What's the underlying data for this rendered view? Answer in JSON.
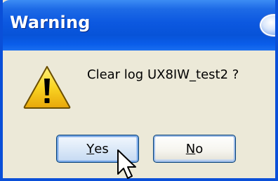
{
  "window": {
    "title": "Warning",
    "message": "Clear log UX8IW_test2 ?"
  },
  "buttons": {
    "yes": {
      "mnemonic": "Y",
      "rest": "es"
    },
    "no": {
      "mnemonic": "N",
      "rest": "o"
    }
  },
  "icons": {
    "warning": "warning-triangle-icon",
    "close": "close-icon",
    "cursor": "mouse-pointer-icon"
  },
  "colors": {
    "title_bar": "#0A5DEA",
    "dialog_bg": "#ECE9D8",
    "warning_yellow": "#F6C611",
    "button_border": "#003C74"
  }
}
